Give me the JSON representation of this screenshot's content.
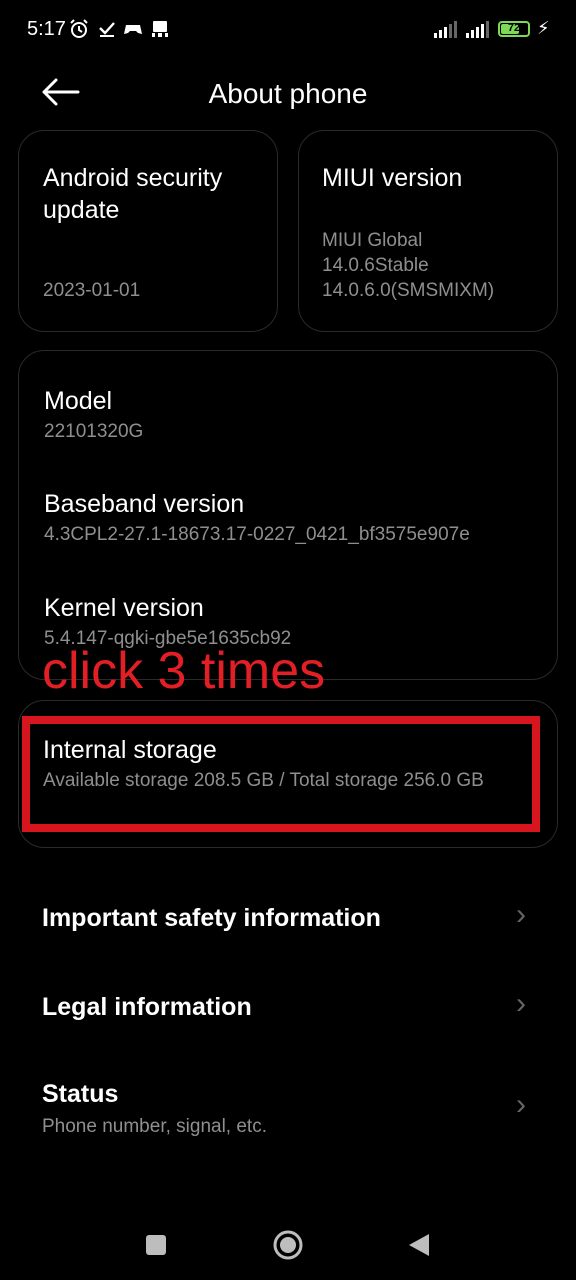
{
  "status": {
    "time": "5:17",
    "battery": "72",
    "battery_fill": 0.72
  },
  "header": {
    "title": "About phone"
  },
  "cards": {
    "security": {
      "title": "Android security update",
      "value": "2023-01-01"
    },
    "miui": {
      "title": "MIUI version",
      "value_line1": "MIUI Global",
      "value_line2": "14.0.6Stable",
      "value_line3": "14.0.6.0(SMSMIXM)"
    }
  },
  "specs": [
    {
      "title": "Model",
      "value": "22101320G"
    },
    {
      "title": "Baseband version",
      "value": "4.3CPL2-27.1-18673.17-0227_0421_bf3575e907e"
    },
    {
      "title": "Kernel version",
      "value": "5.4.147-qgki-gbe5e1635cb92"
    }
  ],
  "annotation": "click 3 times",
  "storage": {
    "title": "Internal storage",
    "value": "Available storage  208.5 GB / Total storage  256.0 GB"
  },
  "rows": [
    {
      "title": "Important safety information"
    },
    {
      "title": "Legal information"
    },
    {
      "title": "Status",
      "sub": "Phone number, signal, etc."
    }
  ]
}
